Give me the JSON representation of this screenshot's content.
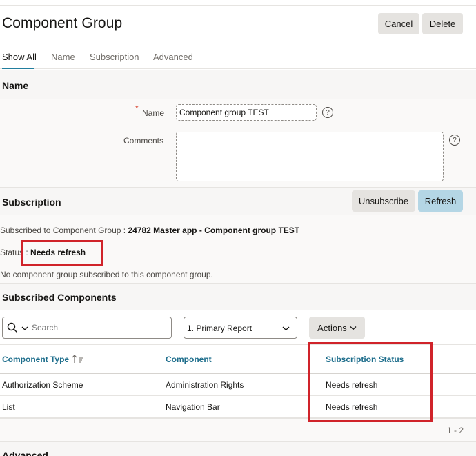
{
  "page": {
    "title": "Component Group",
    "cancel_label": "Cancel",
    "delete_label": "Delete"
  },
  "tabs": [
    {
      "label": "Show All",
      "active": true
    },
    {
      "label": "Name",
      "active": false
    },
    {
      "label": "Subscription",
      "active": false
    },
    {
      "label": "Advanced",
      "active": false
    }
  ],
  "name_section": {
    "title": "Name",
    "required_mark": "*",
    "name_label": "Name",
    "name_value": "Component group TEST",
    "comments_label": "Comments",
    "comments_value": "",
    "help_glyph": "?"
  },
  "subscription": {
    "title": "Subscription",
    "unsubscribe_label": "Unsubscribe",
    "refresh_label": "Refresh",
    "subscribed_to_label": "Subscribed to Component Group : ",
    "subscribed_to_value": "24782 Master app - Component group TEST",
    "status_label": "Status : ",
    "status_value": "Needs refresh",
    "note": "No component group subscribed to this component group."
  },
  "subscribed_components": {
    "title": "Subscribed Components",
    "search_placeholder": "Search",
    "report_select": "1. Primary Report",
    "actions_label": "Actions",
    "columns": [
      "Component Type",
      "Component",
      "Subscription Status"
    ],
    "rows": [
      {
        "type": "Authorization Scheme",
        "component": "Administration Rights",
        "status": "Needs refresh"
      },
      {
        "type": "List",
        "component": "Navigation Bar",
        "status": "Needs refresh"
      }
    ],
    "pagination": "1 - 2"
  },
  "advanced": {
    "title": "Advanced"
  },
  "colors": {
    "accent": "#227e9e",
    "highlight": "#d0232a",
    "refresh_button": "#b4d6e5"
  },
  "icons": [
    "search-icon",
    "chevron-down-icon",
    "help-icon",
    "sort-ascending-icon"
  ]
}
